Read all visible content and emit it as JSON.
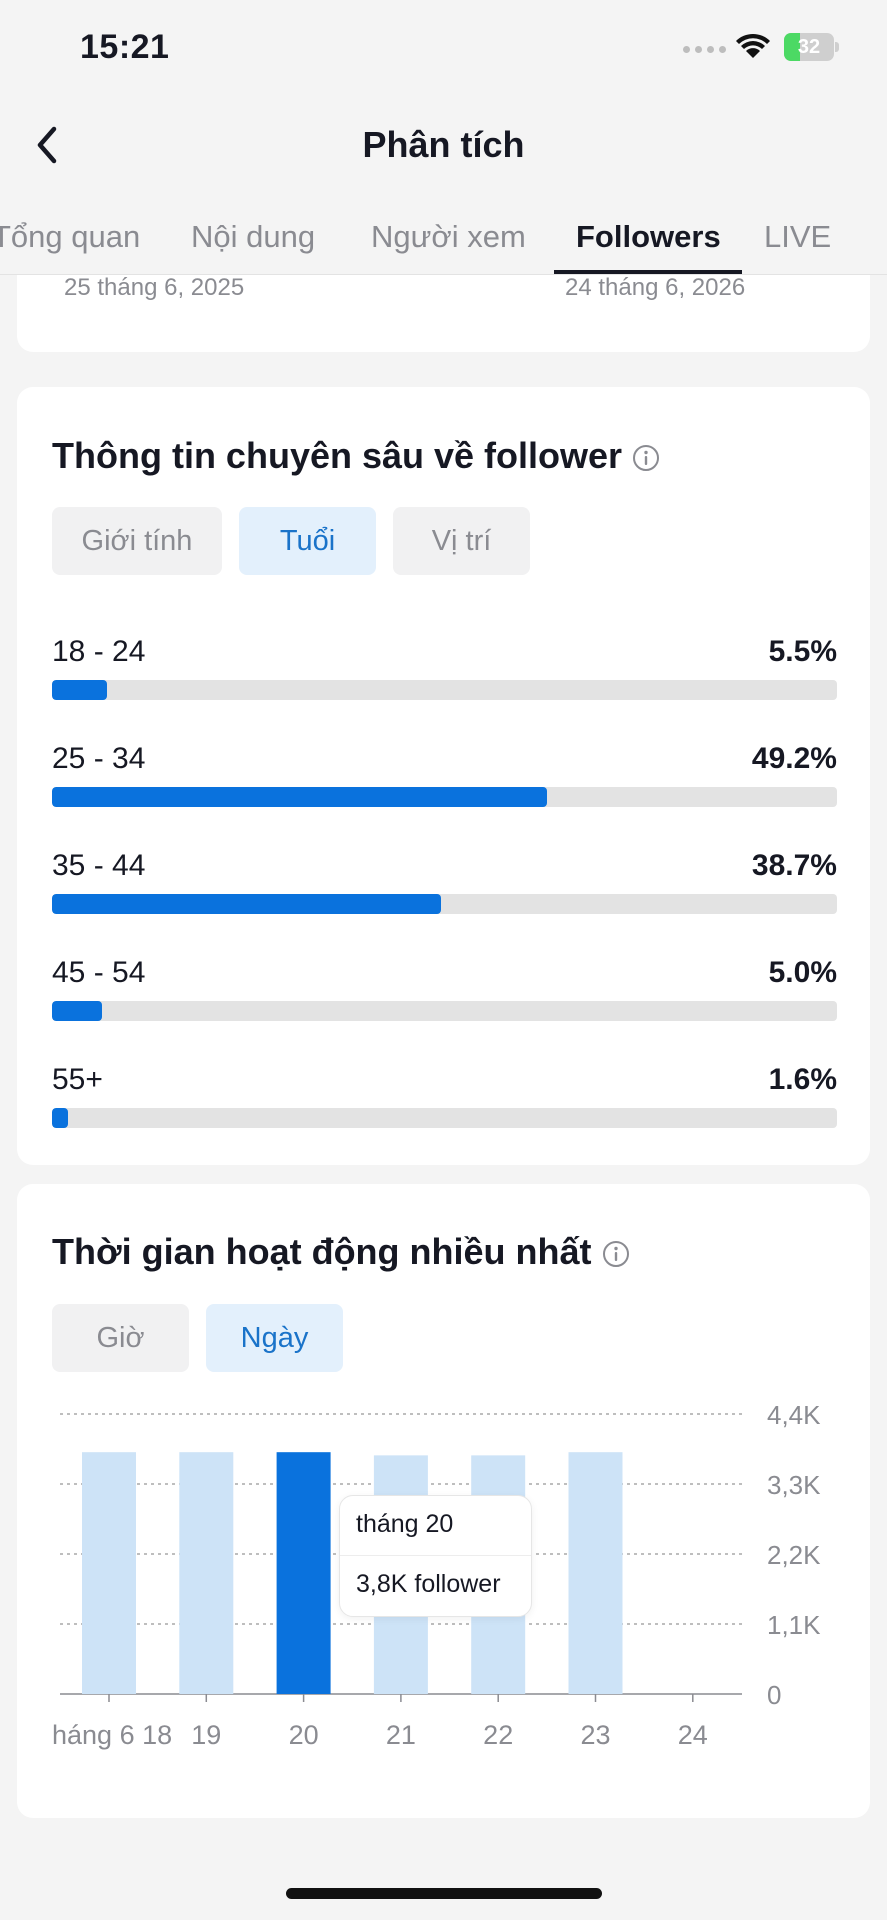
{
  "status_bar": {
    "time": "15:21",
    "battery": "32",
    "battery_level": 0.32
  },
  "nav": {
    "title": "Phân tích"
  },
  "tabs": [
    {
      "label": "Tổng quan",
      "active": false
    },
    {
      "label": "Nội dung",
      "active": false
    },
    {
      "label": "Người xem",
      "active": false
    },
    {
      "label": "Followers",
      "active": true
    },
    {
      "label": "LIVE",
      "active": false
    }
  ],
  "date_range": {
    "start": "25 tháng 6, 2025",
    "end": "24 tháng 6, 2026"
  },
  "follower_insights": {
    "title": "Thông tin chuyên sâu về follower",
    "filters": [
      {
        "label": "Giới tính",
        "active": false
      },
      {
        "label": "Tuổi",
        "active": true
      },
      {
        "label": "Vị trí",
        "active": false
      }
    ],
    "age_groups": [
      {
        "label": "18 - 24",
        "percent_text": "5.5%",
        "value": 5.5
      },
      {
        "label": "25 - 34",
        "percent_text": "49.2%",
        "value": 49.2
      },
      {
        "label": "35 - 44",
        "percent_text": "38.7%",
        "value": 38.7
      },
      {
        "label": "45 - 54",
        "percent_text": "5.0%",
        "value": 5.0
      },
      {
        "label": "55+",
        "percent_text": "1.6%",
        "value": 1.6
      }
    ]
  },
  "active_times": {
    "title": "Thời gian hoạt động nhiều nhất",
    "filters": [
      {
        "label": "Giờ",
        "active": false
      },
      {
        "label": "Ngày",
        "active": true
      }
    ],
    "tooltip": {
      "label": "tháng 20",
      "value": "3,8K follower"
    }
  },
  "colors": {
    "accent": "#0a72dd",
    "bar_light": "#cde3f7",
    "track": "#e3e3e3",
    "chip_active_bg": "#e3f0fc",
    "chip_active_text": "#1a73c9"
  },
  "chart_data": {
    "type": "bar",
    "categories": [
      "háng 6 18",
      "19",
      "20",
      "21",
      "22",
      "23",
      "24"
    ],
    "values": [
      3.8,
      3.8,
      3.8,
      3.75,
      3.75,
      3.8,
      0
    ],
    "highlight_index": 2,
    "y_ticks": [
      "0",
      "1,1K",
      "2,2K",
      "3,3K",
      "4,4K"
    ],
    "ylim": [
      0,
      4.4
    ],
    "grid": true
  }
}
